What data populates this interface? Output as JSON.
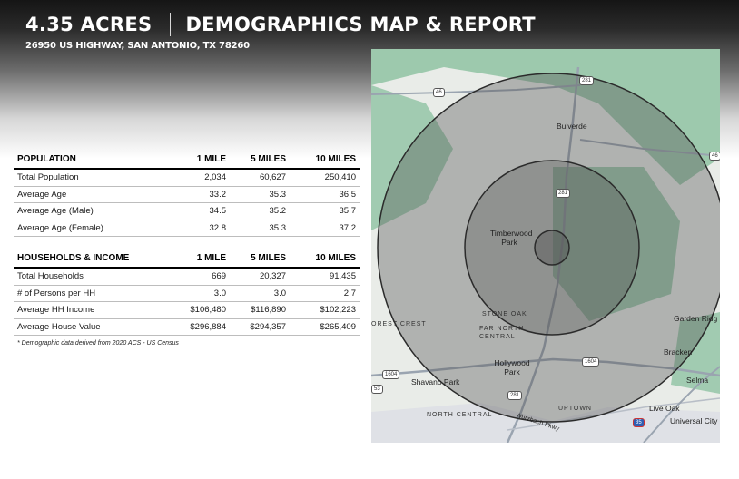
{
  "header": {
    "acreage": "4.35 ACRES",
    "title": "DEMOGRAPHICS MAP & REPORT",
    "address": "26950 US HIGHWAY, SAN ANTONIO, TX 78260"
  },
  "population": {
    "headers": [
      "POPULATION",
      "1 MILE",
      "5 MILES",
      "10 MILES"
    ],
    "rows": [
      [
        "Total Population",
        "2,034",
        "60,627",
        "250,410"
      ],
      [
        "Average Age",
        "33.2",
        "35.3",
        "36.5"
      ],
      [
        "Average Age (Male)",
        "34.5",
        "35.2",
        "35.7"
      ],
      [
        "Average Age (Female)",
        "32.8",
        "35.3",
        "37.2"
      ]
    ]
  },
  "households": {
    "headers": [
      "HOUSEHOLDS & INCOME",
      "1 MILE",
      "5 MILES",
      "10 MILES"
    ],
    "rows": [
      [
        "Total Households",
        "669",
        "20,327",
        "91,435"
      ],
      [
        "# of Persons per HH",
        "3.0",
        "3.0",
        "2.7"
      ],
      [
        "Average HH Income",
        "$106,480",
        "$116,890",
        "$102,223"
      ],
      [
        "Average House Value",
        "$296,884",
        "$294,357",
        "$265,409"
      ]
    ]
  },
  "footnote": "* Demographic data derived from 2020 ACS - US Census",
  "map": {
    "labels": {
      "bulverde": "Bulverde",
      "timberwood": "Timberwood Park",
      "stone_oak": "STONE OAK",
      "far_north_central": "FAR NORTH CENTRAL",
      "garden_ridge": "Garden Ridg",
      "bracken": "Bracken",
      "hollywood_park": "Hollywood Park",
      "selma": "Selma",
      "shavano_park": "Shavano Park",
      "north_central": "NORTH CENTRAL",
      "uptown": "UPTOWN",
      "live_oak": "Live Oak",
      "universal_city": "Universal City",
      "forest_crest": "OREST CREST",
      "wurzbach": "Wurzbach Pkwy"
    },
    "shields": {
      "r46a": "46",
      "r281a": "281",
      "r46b": "46",
      "r281b": "281",
      "r1604a": "1604",
      "r1604b": "1604",
      "r1604c": "1604",
      "r281c": "281",
      "r53": "53",
      "i35": "35"
    },
    "colors": {
      "ring_fill": "#555555",
      "ring_stroke": "#2b2b2b",
      "park_green": "#8fc3a2",
      "land": "#e9ece8"
    }
  }
}
